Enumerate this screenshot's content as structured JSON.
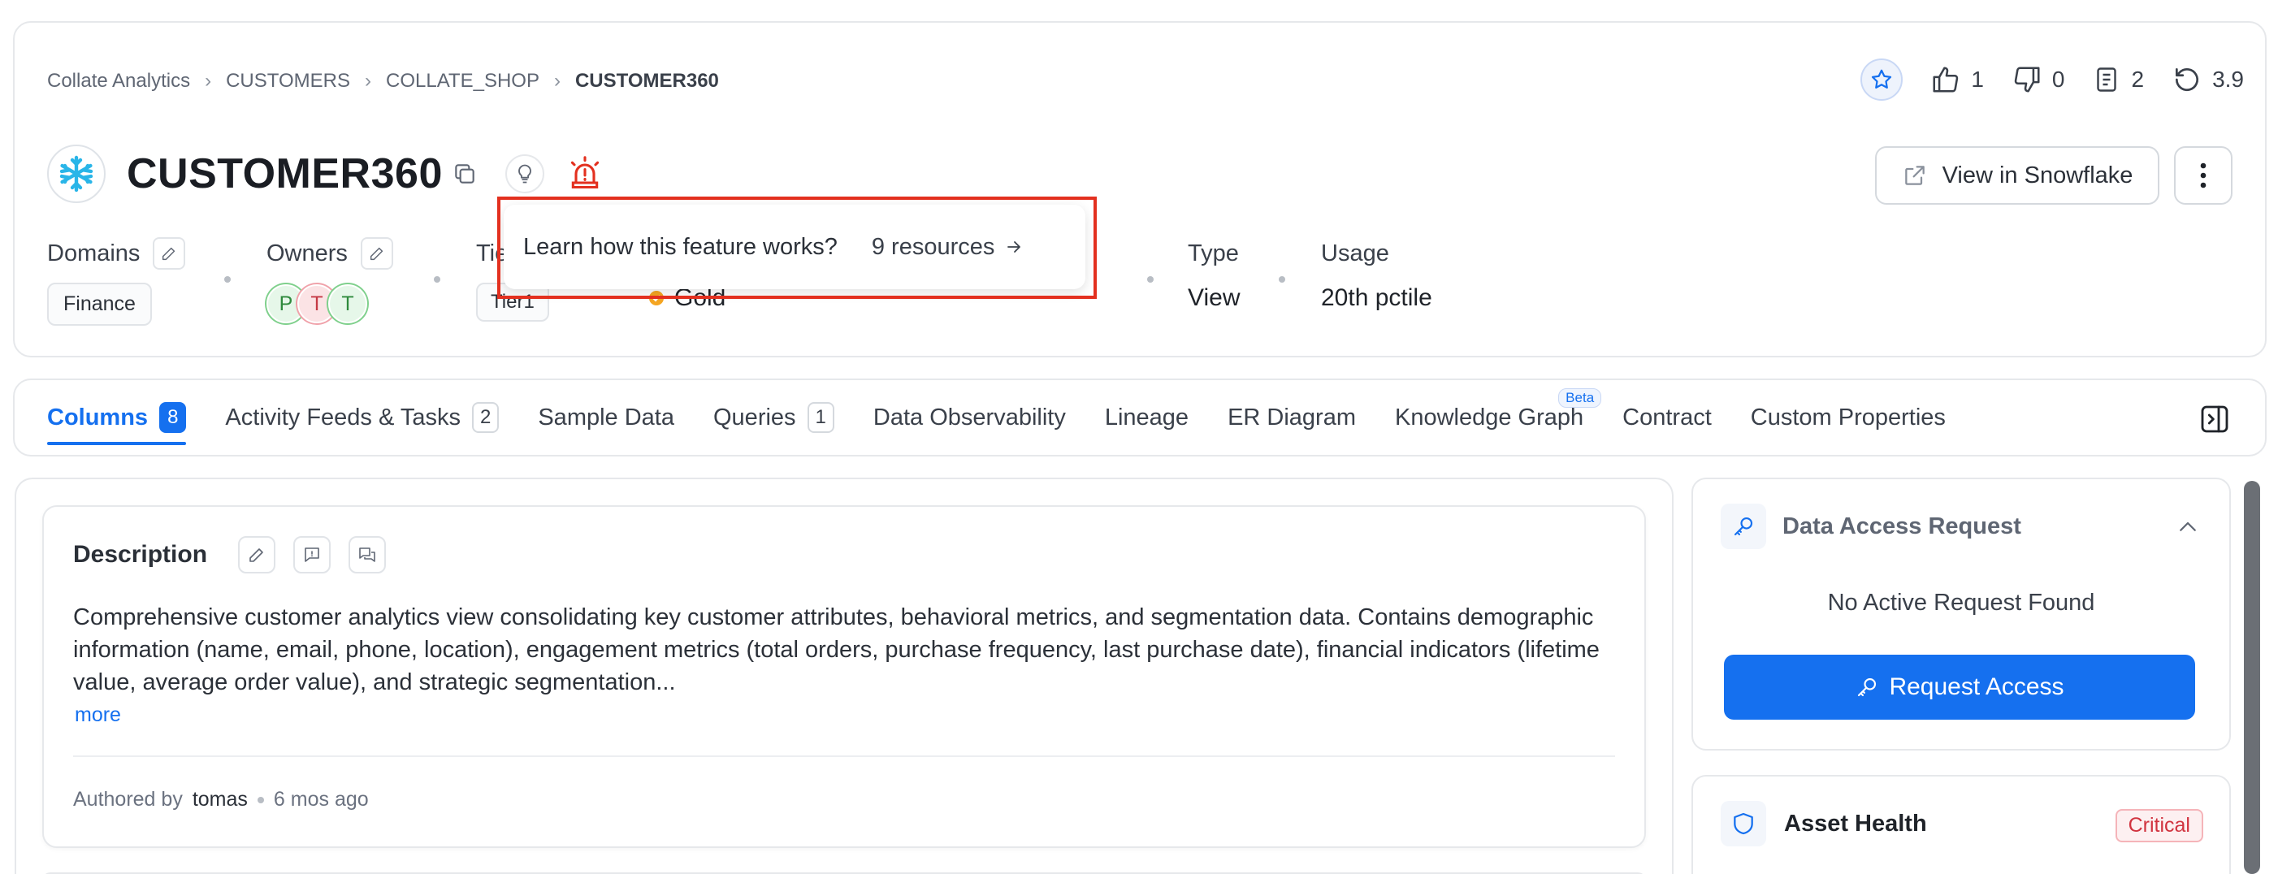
{
  "breadcrumb": {
    "items": [
      "Collate Analytics",
      "CUSTOMERS",
      "COLLATE_SHOP",
      "CUSTOMER360"
    ]
  },
  "actions": {
    "likes": "1",
    "dislikes": "0",
    "docs": "2",
    "version": "3.9"
  },
  "entity": {
    "title": "CUSTOMER360",
    "view_in_label": "View in Snowflake"
  },
  "meta": {
    "domains_label": "Domains",
    "domains_value": "Finance",
    "owners_label": "Owners",
    "owners": [
      "P",
      "T",
      "T"
    ],
    "tier_label": "Tie",
    "tier_value": "Tier1",
    "certification_value": "Gold",
    "type_label": "Type",
    "type_value": "View",
    "usage_label": "Usage",
    "usage_value": "20th pctile"
  },
  "tooltip": {
    "question": "Learn how this feature works?",
    "resources": "9 resources"
  },
  "tabs": [
    {
      "label": "Columns",
      "count": "8"
    },
    {
      "label": "Activity Feeds & Tasks",
      "count": "2"
    },
    {
      "label": "Sample Data"
    },
    {
      "label": "Queries",
      "count": "1"
    },
    {
      "label": "Data Observability"
    },
    {
      "label": "Lineage"
    },
    {
      "label": "ER Diagram"
    },
    {
      "label": "Knowledge Graph",
      "badge": "Beta"
    },
    {
      "label": "Contract"
    },
    {
      "label": "Custom Properties"
    }
  ],
  "description": {
    "title": "Description",
    "text": "Comprehensive customer analytics view consolidating key customer attributes, behavioral metrics, and segmentation data. Contains demographic information (name, email, phone, location), engagement metrics (total orders, purchase frequency, last purchase date), financial indicators (lifetime value, average order value), and strategic segmentation...",
    "more": "more",
    "authored_by_label": "Authored by",
    "author": "tomas",
    "time": "6 mos ago"
  },
  "data_access": {
    "title": "Data Access Request",
    "empty": "No Active Request Found",
    "button": "Request Access"
  },
  "asset_health": {
    "title": "Asset Health",
    "status": "Critical"
  },
  "colors": {
    "accent": "#1570ef",
    "alert": "#e3301f",
    "critical": "#d1333f"
  }
}
